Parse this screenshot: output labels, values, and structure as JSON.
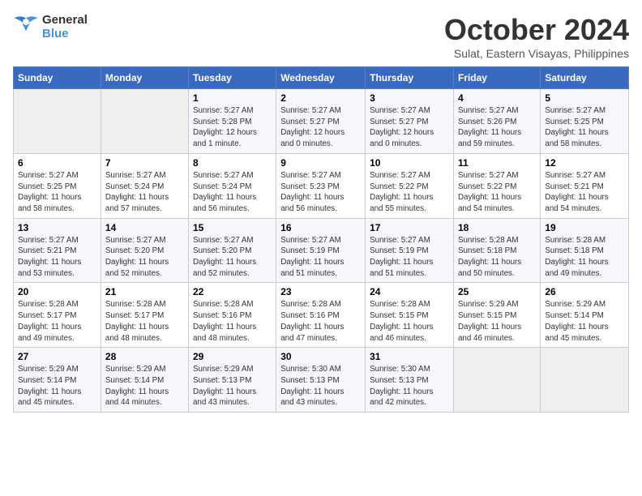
{
  "header": {
    "logo_line1": "General",
    "logo_line2": "Blue",
    "month": "October 2024",
    "location": "Sulat, Eastern Visayas, Philippines"
  },
  "days_of_week": [
    "Sunday",
    "Monday",
    "Tuesday",
    "Wednesday",
    "Thursday",
    "Friday",
    "Saturday"
  ],
  "weeks": [
    [
      {
        "day": "",
        "info": ""
      },
      {
        "day": "",
        "info": ""
      },
      {
        "day": "1",
        "info": "Sunrise: 5:27 AM\nSunset: 5:28 PM\nDaylight: 12 hours\nand 1 minute."
      },
      {
        "day": "2",
        "info": "Sunrise: 5:27 AM\nSunset: 5:27 PM\nDaylight: 12 hours\nand 0 minutes."
      },
      {
        "day": "3",
        "info": "Sunrise: 5:27 AM\nSunset: 5:27 PM\nDaylight: 12 hours\nand 0 minutes."
      },
      {
        "day": "4",
        "info": "Sunrise: 5:27 AM\nSunset: 5:26 PM\nDaylight: 11 hours\nand 59 minutes."
      },
      {
        "day": "5",
        "info": "Sunrise: 5:27 AM\nSunset: 5:25 PM\nDaylight: 11 hours\nand 58 minutes."
      }
    ],
    [
      {
        "day": "6",
        "info": "Sunrise: 5:27 AM\nSunset: 5:25 PM\nDaylight: 11 hours\nand 58 minutes."
      },
      {
        "day": "7",
        "info": "Sunrise: 5:27 AM\nSunset: 5:24 PM\nDaylight: 11 hours\nand 57 minutes."
      },
      {
        "day": "8",
        "info": "Sunrise: 5:27 AM\nSunset: 5:24 PM\nDaylight: 11 hours\nand 56 minutes."
      },
      {
        "day": "9",
        "info": "Sunrise: 5:27 AM\nSunset: 5:23 PM\nDaylight: 11 hours\nand 56 minutes."
      },
      {
        "day": "10",
        "info": "Sunrise: 5:27 AM\nSunset: 5:22 PM\nDaylight: 11 hours\nand 55 minutes."
      },
      {
        "day": "11",
        "info": "Sunrise: 5:27 AM\nSunset: 5:22 PM\nDaylight: 11 hours\nand 54 minutes."
      },
      {
        "day": "12",
        "info": "Sunrise: 5:27 AM\nSunset: 5:21 PM\nDaylight: 11 hours\nand 54 minutes."
      }
    ],
    [
      {
        "day": "13",
        "info": "Sunrise: 5:27 AM\nSunset: 5:21 PM\nDaylight: 11 hours\nand 53 minutes."
      },
      {
        "day": "14",
        "info": "Sunrise: 5:27 AM\nSunset: 5:20 PM\nDaylight: 11 hours\nand 52 minutes."
      },
      {
        "day": "15",
        "info": "Sunrise: 5:27 AM\nSunset: 5:20 PM\nDaylight: 11 hours\nand 52 minutes."
      },
      {
        "day": "16",
        "info": "Sunrise: 5:27 AM\nSunset: 5:19 PM\nDaylight: 11 hours\nand 51 minutes."
      },
      {
        "day": "17",
        "info": "Sunrise: 5:27 AM\nSunset: 5:19 PM\nDaylight: 11 hours\nand 51 minutes."
      },
      {
        "day": "18",
        "info": "Sunrise: 5:28 AM\nSunset: 5:18 PM\nDaylight: 11 hours\nand 50 minutes."
      },
      {
        "day": "19",
        "info": "Sunrise: 5:28 AM\nSunset: 5:18 PM\nDaylight: 11 hours\nand 49 minutes."
      }
    ],
    [
      {
        "day": "20",
        "info": "Sunrise: 5:28 AM\nSunset: 5:17 PM\nDaylight: 11 hours\nand 49 minutes."
      },
      {
        "day": "21",
        "info": "Sunrise: 5:28 AM\nSunset: 5:17 PM\nDaylight: 11 hours\nand 48 minutes."
      },
      {
        "day": "22",
        "info": "Sunrise: 5:28 AM\nSunset: 5:16 PM\nDaylight: 11 hours\nand 48 minutes."
      },
      {
        "day": "23",
        "info": "Sunrise: 5:28 AM\nSunset: 5:16 PM\nDaylight: 11 hours\nand 47 minutes."
      },
      {
        "day": "24",
        "info": "Sunrise: 5:28 AM\nSunset: 5:15 PM\nDaylight: 11 hours\nand 46 minutes."
      },
      {
        "day": "25",
        "info": "Sunrise: 5:29 AM\nSunset: 5:15 PM\nDaylight: 11 hours\nand 46 minutes."
      },
      {
        "day": "26",
        "info": "Sunrise: 5:29 AM\nSunset: 5:14 PM\nDaylight: 11 hours\nand 45 minutes."
      }
    ],
    [
      {
        "day": "27",
        "info": "Sunrise: 5:29 AM\nSunset: 5:14 PM\nDaylight: 11 hours\nand 45 minutes."
      },
      {
        "day": "28",
        "info": "Sunrise: 5:29 AM\nSunset: 5:14 PM\nDaylight: 11 hours\nand 44 minutes."
      },
      {
        "day": "29",
        "info": "Sunrise: 5:29 AM\nSunset: 5:13 PM\nDaylight: 11 hours\nand 43 minutes."
      },
      {
        "day": "30",
        "info": "Sunrise: 5:30 AM\nSunset: 5:13 PM\nDaylight: 11 hours\nand 43 minutes."
      },
      {
        "day": "31",
        "info": "Sunrise: 5:30 AM\nSunset: 5:13 PM\nDaylight: 11 hours\nand 42 minutes."
      },
      {
        "day": "",
        "info": ""
      },
      {
        "day": "",
        "info": ""
      }
    ]
  ]
}
